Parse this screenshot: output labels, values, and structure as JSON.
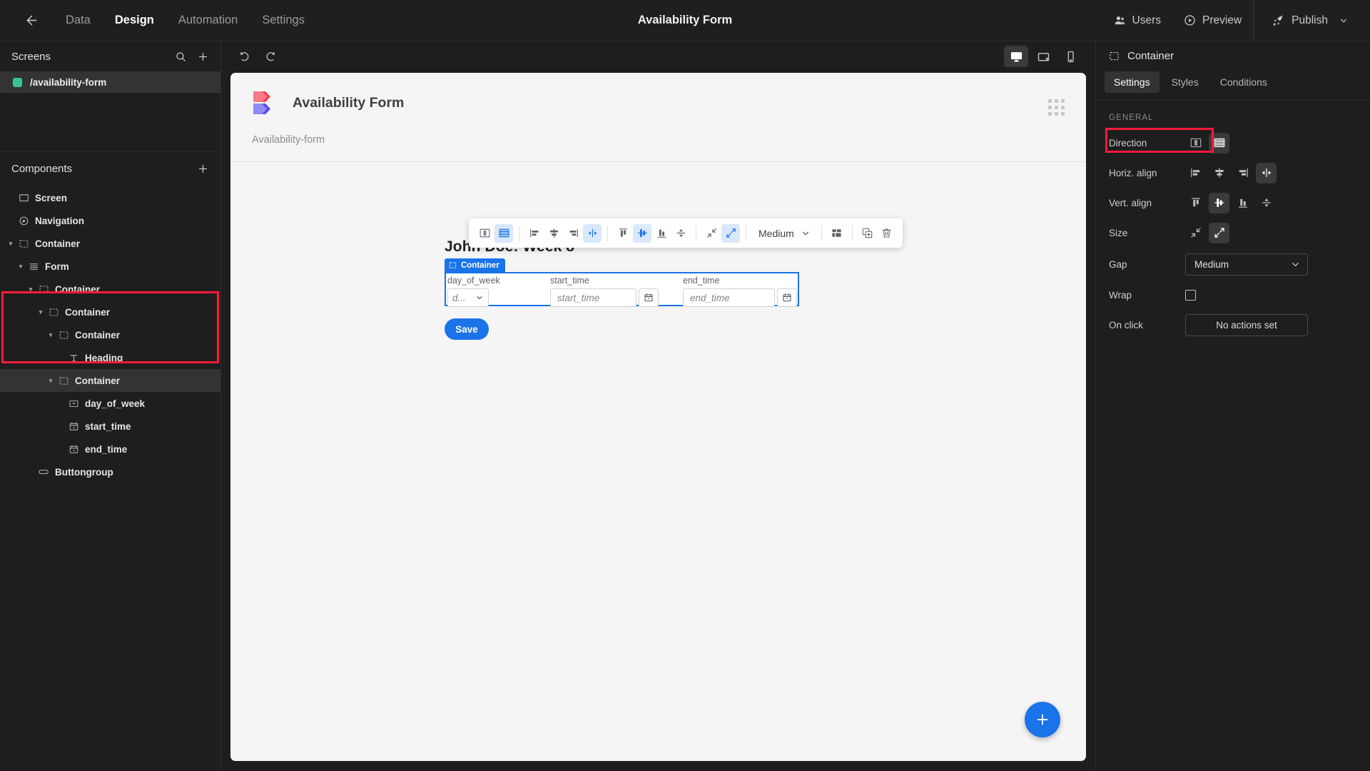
{
  "topbar": {
    "back_icon": "arrow-left-icon",
    "nav": [
      {
        "label": "Data",
        "active": false
      },
      {
        "label": "Design",
        "active": true
      },
      {
        "label": "Automation",
        "active": false
      },
      {
        "label": "Settings",
        "active": false
      }
    ],
    "title": "Availability Form",
    "users_label": "Users",
    "preview_label": "Preview",
    "publish_label": "Publish"
  },
  "left_panel": {
    "screens": {
      "title": "Screens",
      "search_icon": "search-icon",
      "add_icon": "plus-icon",
      "items": [
        {
          "label": "/availability-form",
          "dot_color": "#35c496",
          "selected": true
        }
      ]
    },
    "components": {
      "title": "Components",
      "add_icon": "plus-icon",
      "tree": [
        {
          "label": "Screen",
          "depth": 0,
          "icon": "screen-icon",
          "caret": false,
          "selected": false,
          "highlighted": false
        },
        {
          "label": "Navigation",
          "depth": 0,
          "icon": "navigation-icon",
          "caret": false,
          "selected": false,
          "highlighted": false
        },
        {
          "label": "Container",
          "depth": 0,
          "icon": "container-icon",
          "caret": true,
          "selected": false,
          "highlighted": false
        },
        {
          "label": "Form",
          "depth": 1,
          "icon": "form-icon",
          "caret": true,
          "selected": false,
          "highlighted": false
        },
        {
          "label": "Container",
          "depth": 2,
          "icon": "container-icon",
          "caret": true,
          "selected": false,
          "highlighted": false
        },
        {
          "label": "Container",
          "depth": 3,
          "icon": "container-icon",
          "caret": true,
          "selected": false,
          "highlighted": false
        },
        {
          "label": "Container",
          "depth": 4,
          "icon": "container-icon",
          "caret": true,
          "selected": false,
          "highlighted": false
        },
        {
          "label": "Heading",
          "depth": 5,
          "icon": "text-icon",
          "caret": false,
          "selected": false,
          "highlighted": false
        },
        {
          "label": "Container",
          "depth": 4,
          "icon": "container-icon",
          "caret": true,
          "selected": true,
          "highlighted": true
        },
        {
          "label": "day_of_week",
          "depth": 5,
          "icon": "select-icon",
          "caret": false,
          "selected": false,
          "highlighted": true
        },
        {
          "label": "start_time",
          "depth": 5,
          "icon": "calendar-icon",
          "caret": false,
          "selected": false,
          "highlighted": true
        },
        {
          "label": "end_time",
          "depth": 5,
          "icon": "calendar-icon",
          "caret": false,
          "selected": false,
          "highlighted": true
        },
        {
          "label": "Buttongroup",
          "depth": 3,
          "icon": "buttongroup-icon",
          "caret": false,
          "selected": false,
          "highlighted": false
        }
      ]
    }
  },
  "canvas": {
    "undo_icon": "undo-icon",
    "redo_icon": "redo-icon",
    "devices": [
      {
        "name": "desktop-icon",
        "active": true
      },
      {
        "name": "tablet-icon",
        "active": false
      },
      {
        "name": "mobile-icon",
        "active": false
      }
    ],
    "app_title": "Availability Form",
    "grip_icon": "grid-dots-icon",
    "breadcrumb": "Availability-form",
    "heading": "John Doe: Week 8",
    "container_tag": "Container",
    "fields": [
      {
        "label": "day_of_week",
        "type": "select",
        "placeholder": "d..."
      },
      {
        "label": "start_time",
        "type": "date",
        "placeholder": "start_time"
      },
      {
        "label": "end_time",
        "type": "date",
        "placeholder": "end_time"
      }
    ],
    "save_label": "Save",
    "fab_icon": "plus-icon"
  },
  "element_toolbar": {
    "groups": [
      {
        "buttons": [
          {
            "icon": "layout-columns-icon",
            "active": false
          },
          {
            "icon": "layout-rows-icon",
            "active": true
          }
        ]
      },
      {
        "buttons": [
          {
            "icon": "align-left-icon",
            "active": false
          },
          {
            "icon": "align-center-icon",
            "active": false
          },
          {
            "icon": "align-right-icon",
            "active": false
          },
          {
            "icon": "align-space-between-icon",
            "active": true
          }
        ]
      },
      {
        "buttons": [
          {
            "icon": "align-top-icon",
            "active": false
          },
          {
            "icon": "align-middle-icon",
            "active": true
          },
          {
            "icon": "align-bottom-icon",
            "active": false
          },
          {
            "icon": "align-stretch-vertical-icon",
            "active": false
          }
        ]
      },
      {
        "buttons": [
          {
            "icon": "shrink-icon",
            "active": false
          },
          {
            "icon": "grow-icon",
            "active": true
          }
        ]
      }
    ],
    "gap_value": "Medium",
    "gap_chevron_icon": "chevron-down-icon",
    "grid_icon": "grid-layout-icon",
    "duplicate_icon": "duplicate-icon",
    "delete_icon": "trash-icon"
  },
  "right_panel": {
    "header_title": "Container",
    "header_icon": "container-icon",
    "tabs": [
      {
        "label": "Settings",
        "active": true
      },
      {
        "label": "Styles",
        "active": false
      },
      {
        "label": "Conditions",
        "active": false
      }
    ],
    "section_title": "GENERAL",
    "properties": {
      "direction": {
        "label": "Direction",
        "options": [
          {
            "icon": "direction-column-icon",
            "active": false
          },
          {
            "icon": "direction-row-icon",
            "active": true
          }
        ]
      },
      "horiz_align": {
        "label": "Horiz. align",
        "options": [
          {
            "icon": "align-left-icon",
            "active": false
          },
          {
            "icon": "align-center-icon",
            "active": false
          },
          {
            "icon": "align-right-icon",
            "active": false
          },
          {
            "icon": "align-space-between-icon",
            "active": true
          }
        ]
      },
      "vert_align": {
        "label": "Vert. align",
        "options": [
          {
            "icon": "align-top-icon",
            "active": false
          },
          {
            "icon": "align-middle-icon",
            "active": true
          },
          {
            "icon": "align-bottom-icon",
            "active": false
          },
          {
            "icon": "align-stretch-vertical-icon",
            "active": false
          }
        ]
      },
      "size": {
        "label": "Size",
        "options": [
          {
            "icon": "shrink-icon",
            "active": false
          },
          {
            "icon": "grow-icon",
            "active": true
          }
        ]
      },
      "gap": {
        "label": "Gap",
        "value": "Medium",
        "chevron_icon": "chevron-down-icon"
      },
      "wrap": {
        "label": "Wrap",
        "checked": false
      },
      "on_click": {
        "label": "On click",
        "value": "No actions set"
      }
    }
  },
  "colors": {
    "accent_blue": "#1a73e8",
    "annotation_red": "#ff1b3a",
    "screen_dot_green": "#35c496",
    "panel_bg": "#1e1e1e",
    "canvas_bg": "#f5f5f5"
  }
}
